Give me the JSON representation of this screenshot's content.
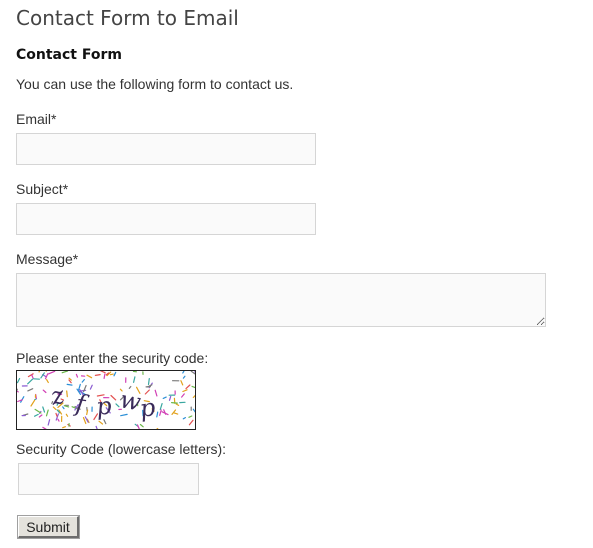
{
  "page": {
    "title": "Contact Form to Email"
  },
  "form": {
    "title": "Contact Form",
    "intro": "You can use the following form to contact us.",
    "email_label": "Email*",
    "email_value": "",
    "subject_label": "Subject*",
    "subject_value": "",
    "message_label": "Message*",
    "message_value": "",
    "security_prompt": "Please enter the security code:",
    "captcha_text": "zfpwp",
    "security_code_label": "Security Code (lowercase letters):",
    "security_code_value": "",
    "submit_label": "Submit"
  }
}
